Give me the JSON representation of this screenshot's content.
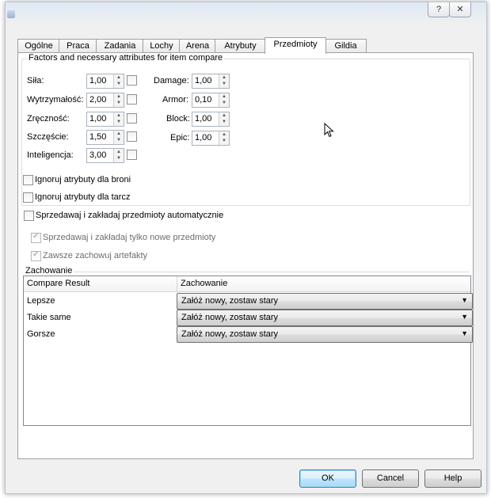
{
  "window": {
    "title_buttons": [
      "?",
      "✕"
    ]
  },
  "tabs": [
    {
      "label": "Ogólne"
    },
    {
      "label": "Praca"
    },
    {
      "label": "Zadania"
    },
    {
      "label": "Lochy"
    },
    {
      "label": "Arena"
    },
    {
      "label": "Atrybuty"
    },
    {
      "label": "Przedmioty"
    },
    {
      "label": "Gildia"
    }
  ],
  "active_tab": "Przedmioty",
  "factors": {
    "title": "Factors and necessary attributes for item compare",
    "left": [
      {
        "label": "Siła:",
        "value": "1,00",
        "checked": false
      },
      {
        "label": "Wytrzymałość:",
        "value": "2,00",
        "checked": false
      },
      {
        "label": "Zręczność:",
        "value": "1,00",
        "checked": false
      },
      {
        "label": "Szczęście:",
        "value": "1,50",
        "checked": false
      },
      {
        "label": "Inteligencja:",
        "value": "3,00",
        "checked": false
      }
    ],
    "right": [
      {
        "label": "Damage:",
        "value": "1,00"
      },
      {
        "label": "Armor:",
        "value": "0,10"
      },
      {
        "label": "Block:",
        "value": "1,00"
      },
      {
        "label": "Epic:",
        "value": "1,00"
      }
    ]
  },
  "options": {
    "ignore_weapon": {
      "label": "Ignoruj atrybuty dla broni",
      "checked": false
    },
    "ignore_shield": {
      "label": "Ignoruj atrybuty dla tarcz",
      "checked": false
    },
    "auto_sell": {
      "label": "Sprzedawaj i zakładaj przedmioty automatycznie",
      "checked": false
    },
    "only_new": {
      "label": "Sprzedawaj i zakładaj tylko nowe przedmioty",
      "checked": true
    },
    "keep_artifacts": {
      "label": "Zawsze zachowuj artefakty",
      "checked": true
    }
  },
  "behavior": {
    "title": "Zachowanie",
    "columns": [
      "Compare Result",
      "Zachowanie"
    ],
    "rows": [
      {
        "result": "Lepsze",
        "action": "Załóż nowy, zostaw stary"
      },
      {
        "result": "Takie same",
        "action": "Załóż nowy, zostaw stary"
      },
      {
        "result": "Gorsze",
        "action": "Załóż nowy, zostaw stary"
      }
    ]
  },
  "buttons": {
    "ok": "OK",
    "cancel": "Cancel",
    "help": "Help"
  }
}
